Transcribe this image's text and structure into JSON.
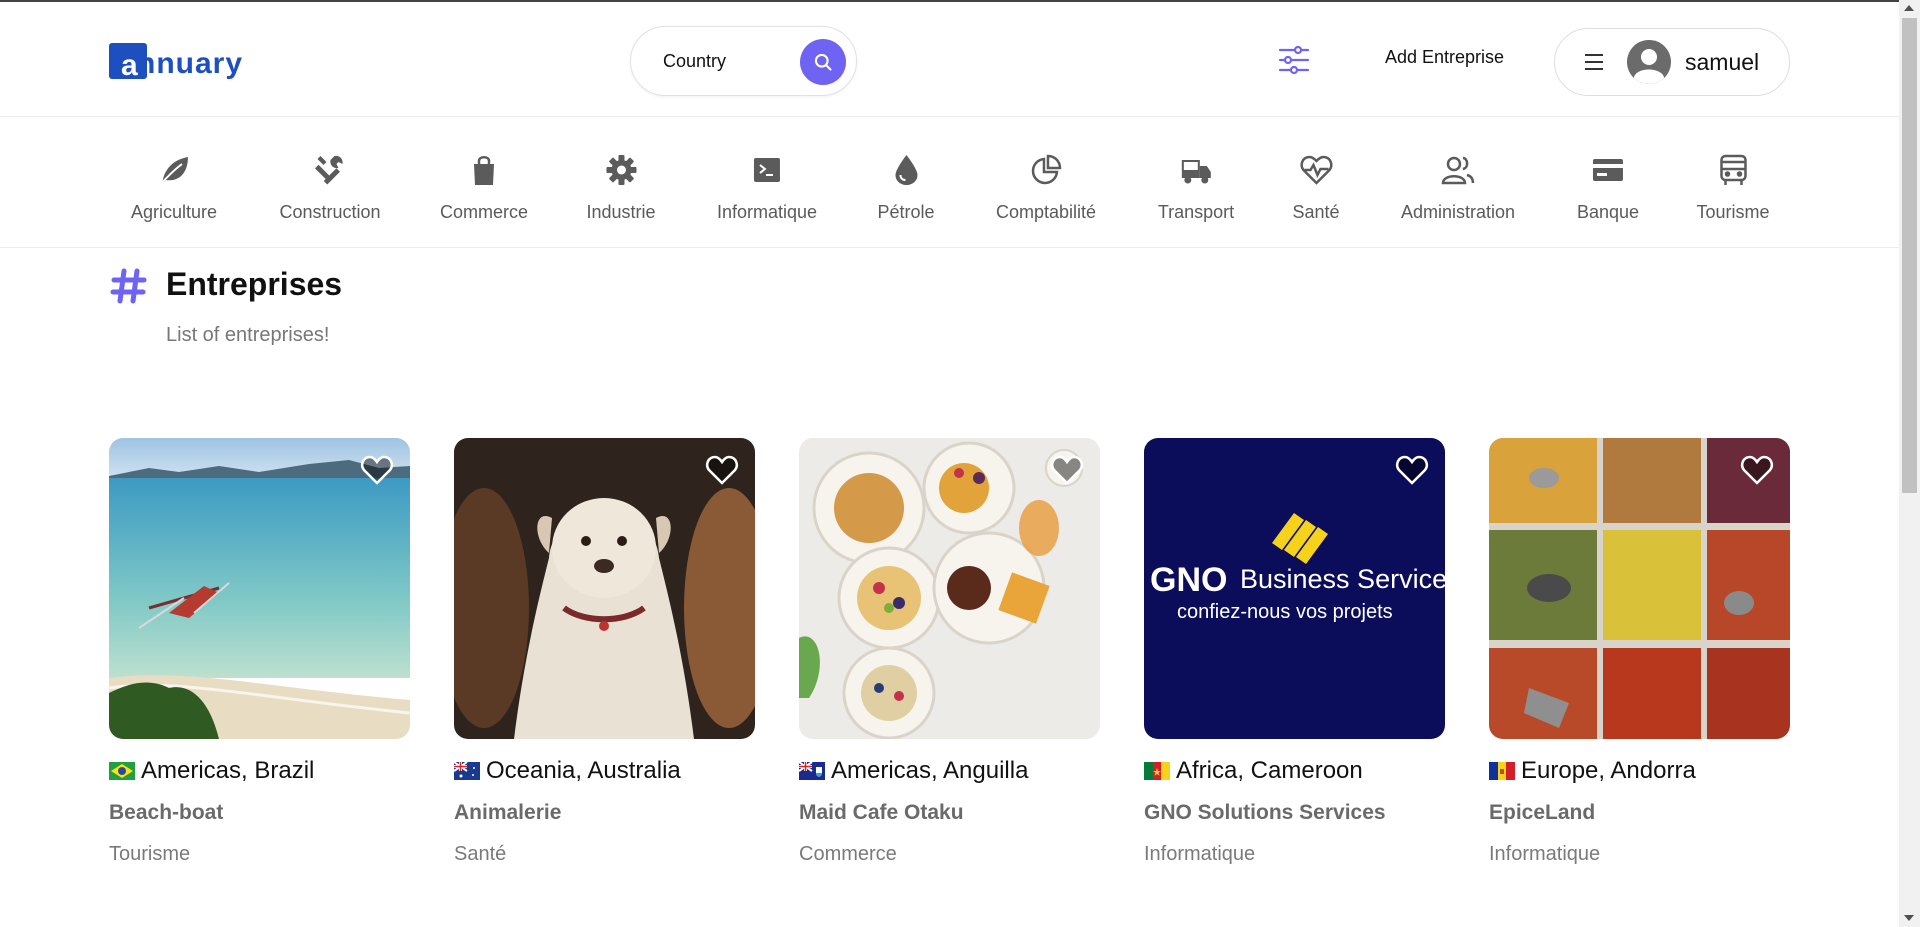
{
  "header": {
    "logo_text": "nnuary",
    "logo_letter": "a",
    "search": {
      "value": "Country",
      "placeholder": "Country"
    },
    "add_label": "Add Entreprise",
    "username": "samuel",
    "accent_color": "#6e63f3",
    "brand_color": "#1e4fc0"
  },
  "categories": [
    {
      "label": "Agriculture",
      "icon": "leaf-icon"
    },
    {
      "label": "Construction",
      "icon": "tools-icon"
    },
    {
      "label": "Commerce",
      "icon": "shopping-bag-icon"
    },
    {
      "label": "Industrie",
      "icon": "gear-icon"
    },
    {
      "label": "Informatique",
      "icon": "terminal-icon"
    },
    {
      "label": "Pétrole",
      "icon": "drop-icon"
    },
    {
      "label": "Comptabilité",
      "icon": "pie-chart-icon"
    },
    {
      "label": "Transport",
      "icon": "truck-icon"
    },
    {
      "label": "Santé",
      "icon": "heart-pulse-icon"
    },
    {
      "label": "Administration",
      "icon": "users-icon"
    },
    {
      "label": "Banque",
      "icon": "credit-card-icon"
    },
    {
      "label": "Tourisme",
      "icon": "bus-icon"
    }
  ],
  "section": {
    "title": "Entreprises",
    "subtitle": "List of entreprises!"
  },
  "cards": [
    {
      "location": "Americas, Brazil",
      "flag": "brazil-flag",
      "name": "Beach-boat",
      "category": "Tourisme"
    },
    {
      "location": "Oceania, Australia",
      "flag": "australia-flag",
      "name": "Animalerie",
      "category": "Santé"
    },
    {
      "location": "Americas, Anguilla",
      "flag": "anguilla-flag",
      "name": "Maid Cafe Otaku",
      "category": "Commerce"
    },
    {
      "location": "Africa, Cameroon",
      "flag": "cameroon-flag",
      "name": "GNO Solutions Services",
      "category": "Informatique",
      "image_text": {
        "brand": "GNO",
        "title": "Business Services",
        "tagline": "confiez-nous vos projets"
      }
    },
    {
      "location": "Europe, Andorra",
      "flag": "andorra-flag",
      "name": "EpiceLand",
      "category": "Informatique"
    }
  ]
}
